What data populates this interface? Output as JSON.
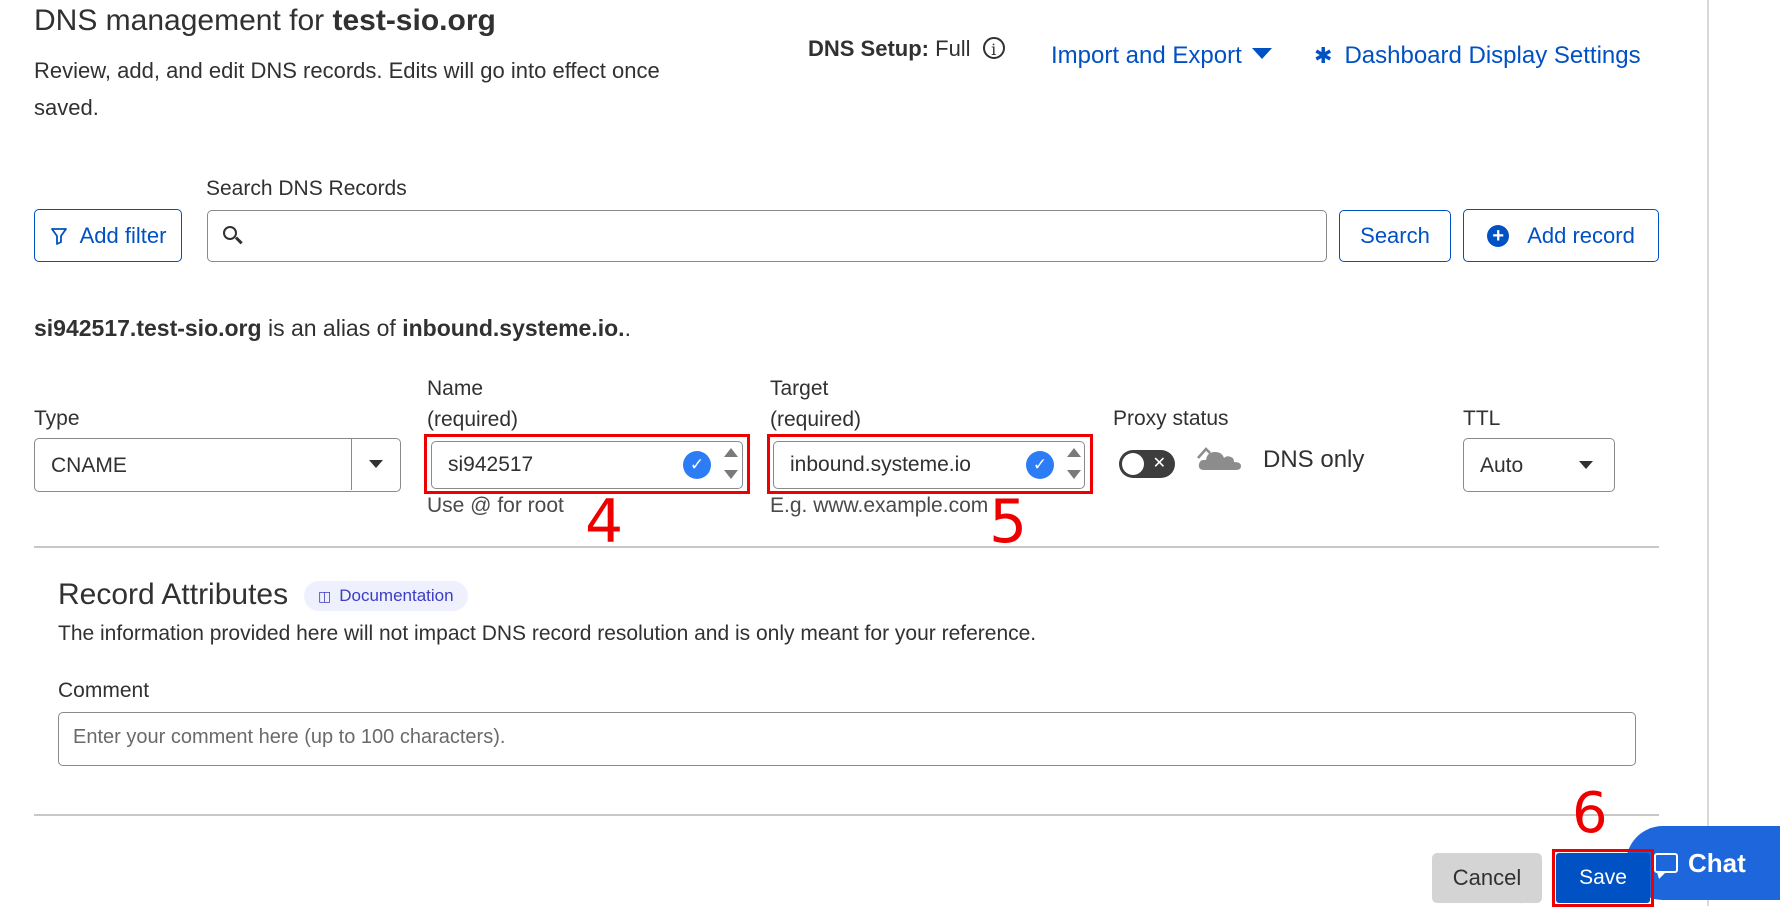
{
  "header": {
    "title_prefix": "DNS management for ",
    "title_domain": "test-sio.org",
    "description": "Review, add, and edit DNS records. Edits will go into effect once saved.",
    "dns_setup_label": "DNS Setup:",
    "dns_setup_value": "Full",
    "import_export": "Import and Export",
    "dashboard_settings": "Dashboard Display Settings"
  },
  "search": {
    "label": "Search DNS Records",
    "add_filter": "Add filter",
    "value": "",
    "search_button": "Search",
    "add_record": "Add record"
  },
  "alias": {
    "host": "si942517.test-sio.org",
    "middle": " is an alias of ",
    "target": "inbound.systeme.io.",
    "end": "."
  },
  "form": {
    "type_label": "Type",
    "type_value": "CNAME",
    "name_label_line1": "Name",
    "name_label_line2": "(required)",
    "name_value": "si942517",
    "name_hint": "Use @ for root",
    "target_label_line1": "Target",
    "target_label_line2": "(required)",
    "target_value": "inbound.systeme.io",
    "target_hint": "E.g. www.example.com",
    "proxy_label": "Proxy status",
    "proxy_enabled": false,
    "proxy_value": "DNS only",
    "ttl_label": "TTL",
    "ttl_value": "Auto"
  },
  "attributes": {
    "title": "Record Attributes",
    "doc_badge": "Documentation",
    "description": "The information provided here will not impact DNS record resolution and is only meant for your reference.",
    "comment_label": "Comment",
    "comment_placeholder": "Enter your comment here (up to 100 characters).",
    "comment_value": ""
  },
  "actions": {
    "cancel": "Cancel",
    "save": "Save",
    "chat": "Chat"
  },
  "annotations": {
    "step_name": "4",
    "step_target": "5",
    "step_save": "6",
    "highlight_color": "#ee0000"
  },
  "colors": {
    "accent": "#0051c3",
    "check": "#2c7cf6",
    "chat": "#1e66dc"
  }
}
